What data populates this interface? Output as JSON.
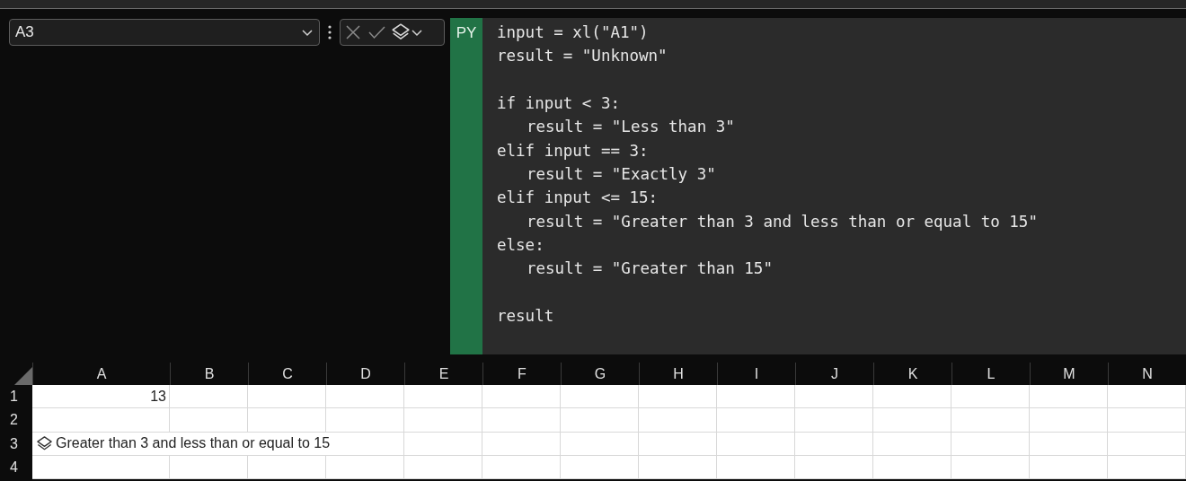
{
  "name_box": {
    "value": "A3"
  },
  "formula_bar": {
    "mode_badge": "PY",
    "code_lines": [
      {
        "kind": "code",
        "text": "input = xl(\"A1\")"
      },
      {
        "kind": "code",
        "text": "result = \"Unknown\""
      },
      {
        "kind": "blank"
      },
      {
        "kind": "code",
        "text": "if input < 3:",
        "children": [
          {
            "kind": "code",
            "text": "result = \"Less than 3\""
          }
        ]
      },
      {
        "kind": "code",
        "text": "elif input == 3:",
        "children": [
          {
            "kind": "code",
            "text": "result = \"Exactly 3\""
          }
        ]
      },
      {
        "kind": "code",
        "text": "elif input <= 15:",
        "children": [
          {
            "kind": "code",
            "text": "result = \"Greater than 3 and less than or equal to 15\""
          }
        ]
      },
      {
        "kind": "code",
        "text": "else:",
        "children": [
          {
            "kind": "code",
            "text": "result = \"Greater than 15\""
          }
        ]
      },
      {
        "kind": "blank"
      },
      {
        "kind": "code",
        "text": "result"
      }
    ]
  },
  "sheet": {
    "columns": [
      "A",
      "B",
      "C",
      "D",
      "E",
      "F",
      "G",
      "H",
      "I",
      "J",
      "K",
      "L",
      "M",
      "N"
    ],
    "rows": [
      {
        "label": "1",
        "cells": [
          {
            "kind": "number",
            "text": "13"
          }
        ]
      },
      {
        "label": "2",
        "cells": []
      },
      {
        "label": "3",
        "cells": [
          {
            "kind": "python",
            "text": "Greater than 3 and less than or equal to 15"
          }
        ]
      },
      {
        "label": "4",
        "cells": []
      }
    ]
  }
}
